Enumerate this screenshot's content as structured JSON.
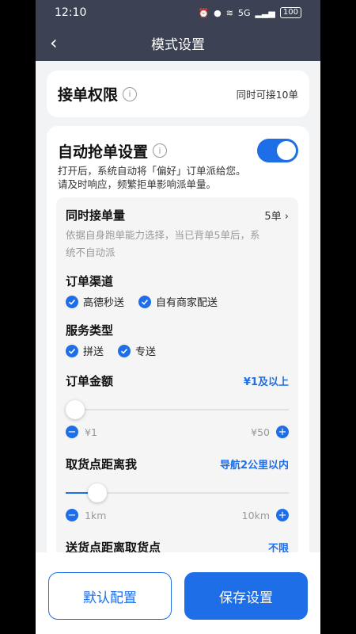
{
  "status_bar": {
    "time": "12:10",
    "network": "5G",
    "battery": "100"
  },
  "nav": {
    "title": "模式设置"
  },
  "accept_limit": {
    "title": "接单权限",
    "value": "同时可接10单"
  },
  "auto_grab": {
    "title": "自动抢单设置",
    "enabled": true,
    "description_line1": "打开后，系统自动将「偏好」订单派给您。",
    "description_line2": "请及时响应，频繁拒单影响派单量。",
    "simultaneous": {
      "label": "同时接单量",
      "value": "5单",
      "note_line1": "依据自身跑单能力选择，当已背单5单后，系",
      "note_line2": "统不自动派"
    },
    "channels": {
      "label": "订单渠道",
      "options": [
        {
          "label": "高德秒送",
          "checked": true
        },
        {
          "label": "自有商家配送",
          "checked": true
        }
      ]
    },
    "service_types": {
      "label": "服务类型",
      "options": [
        {
          "label": "拼送",
          "checked": true
        },
        {
          "label": "专送",
          "checked": true
        }
      ]
    },
    "order_amount": {
      "label": "订单金额",
      "value": "¥1及以上",
      "min_label": "¥1",
      "max_label": "¥50",
      "level": 0
    },
    "pickup_distance": {
      "label": "取货点距离我",
      "value": "导航2公里以内",
      "min_label": "1km",
      "max_label": "10km",
      "level": 0.11
    },
    "delivery_distance": {
      "label": "送货点距离取货点",
      "value": "不限"
    }
  },
  "footer": {
    "default_label": "默认配置",
    "save_label": "保存设置"
  },
  "colors": {
    "accent": "#1e6ee8",
    "header": "#3c4254"
  }
}
